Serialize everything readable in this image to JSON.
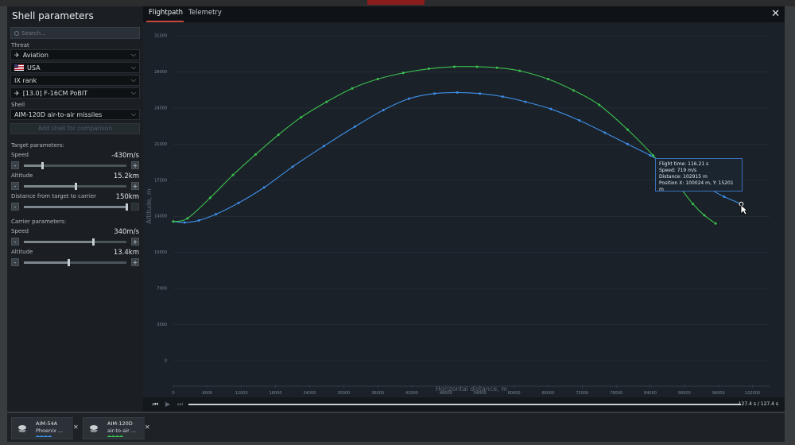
{
  "panel": {
    "title": "Shell parameters",
    "search_placeholder": "Search..."
  },
  "threat": {
    "label": "Threat",
    "type_value": "Aviation",
    "type_icon": "airplane-icon",
    "country_value": "USA",
    "country_icon": "usa-flag-icon",
    "rank_value": "IX rank",
    "vehicle_value": "[13.0] F-16CM PoBIT",
    "vehicle_icon": "jet-icon"
  },
  "shell": {
    "label": "Shell",
    "value": "AIM-120D air-to-air missiles",
    "compare_button": "Add shell for comparison"
  },
  "target": {
    "section": "Target parameters:",
    "speed_label": "Speed",
    "speed_value": "-430m/s",
    "speed_level": 0.18,
    "altitude_label": "Altitude",
    "altitude_value": "15.2km",
    "altitude_level": 0.51,
    "distance_label": "Distance from target to carrier",
    "distance_value": "150km",
    "distance_level": 1.0
  },
  "carrier": {
    "section": "Carrier parameters:",
    "speed_label": "Speed",
    "speed_value": "340m/s",
    "speed_level": 0.68,
    "altitude_label": "Altitude",
    "altitude_value": "13.4km",
    "altitude_level": 0.44
  },
  "stepper": {
    "minus": "-",
    "plus": "+"
  },
  "tabs": [
    {
      "label": "Flightpath",
      "active": true
    },
    {
      "label": "Telemetry",
      "active": false
    }
  ],
  "close_icon": "close-icon",
  "tooltip": {
    "line1": "Flight time: 116.21 s",
    "line2": "Speed: 719 m/s",
    "line3": "Distance: 102915 m",
    "line4": "Position X: 100024 m, Y: 15201 m"
  },
  "playback": {
    "time": "127.4 s  /  127.4 s",
    "progress": 1.0
  },
  "comparison_cards": [
    {
      "line1": "AIM-54A",
      "line2": "Phoenix ...",
      "color": "#3d8fe8"
    },
    {
      "line1": "AIM-120D",
      "line2": "air-to-air ...",
      "color": "#3cc24f"
    }
  ],
  "chart_data": {
    "type": "line",
    "xlabel": "Horizontal distance, m",
    "ylabel": "Altitude, m",
    "xlim": [
      0,
      105000
    ],
    "ylim": [
      0,
      31500
    ],
    "x_ticks": [
      0,
      6000,
      12000,
      18000,
      24000,
      30000,
      36000,
      42000,
      48000,
      54000,
      60000,
      66000,
      72000,
      78000,
      84000,
      90000,
      96000,
      102000
    ],
    "y_ticks": [
      0,
      3500,
      7000,
      10500,
      14000,
      17500,
      21000,
      24500,
      28000,
      31500
    ],
    "grid": true,
    "series": [
      {
        "color": "#3d8fe8",
        "x": [
          0,
          2000,
          4500,
          7500,
          11500,
          16000,
          21000,
          26500,
          32000,
          37000,
          41500,
          46000,
          50000,
          54000,
          58000,
          62000,
          66500,
          71500,
          76000,
          80000,
          84000,
          88000,
          91000,
          94000,
          97000,
          100024
        ],
        "y": [
          13500,
          13400,
          13600,
          14200,
          15300,
          16800,
          18800,
          20800,
          22700,
          24300,
          25400,
          25900,
          26000,
          25900,
          25600,
          25100,
          24400,
          23300,
          22100,
          21000,
          19900,
          18700,
          17800,
          16800,
          15900,
          15201
        ]
      },
      {
        "color": "#3cc24f",
        "x": [
          0,
          2500,
          6500,
          10500,
          14500,
          18500,
          22500,
          27000,
          31500,
          36000,
          40500,
          45000,
          49500,
          53500,
          57000,
          61000,
          66000,
          70500,
          75000,
          80000,
          84500,
          88500,
          91500,
          93500,
          95500
        ],
        "y": [
          13500,
          13800,
          15800,
          18000,
          20000,
          21900,
          23600,
          25100,
          26400,
          27300,
          27900,
          28300,
          28500,
          28500,
          28400,
          28100,
          27300,
          26200,
          24800,
          22400,
          19900,
          17300,
          15200,
          14100,
          13300
        ]
      }
    ],
    "cursor_point": {
      "x": 100024,
      "y": 15201
    }
  }
}
